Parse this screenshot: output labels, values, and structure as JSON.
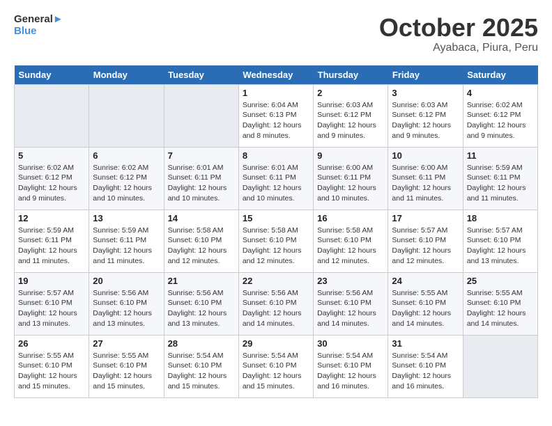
{
  "header": {
    "logo_line1": "General",
    "logo_line2": "Blue",
    "month": "October 2025",
    "location": "Ayabaca, Piura, Peru"
  },
  "weekdays": [
    "Sunday",
    "Monday",
    "Tuesday",
    "Wednesday",
    "Thursday",
    "Friday",
    "Saturday"
  ],
  "weeks": [
    [
      {
        "day": "",
        "empty": true
      },
      {
        "day": "",
        "empty": true
      },
      {
        "day": "",
        "empty": true
      },
      {
        "day": "1",
        "lines": [
          "Sunrise: 6:04 AM",
          "Sunset: 6:13 PM",
          "Daylight: 12 hours",
          "and 8 minutes."
        ]
      },
      {
        "day": "2",
        "lines": [
          "Sunrise: 6:03 AM",
          "Sunset: 6:12 PM",
          "Daylight: 12 hours",
          "and 9 minutes."
        ]
      },
      {
        "day": "3",
        "lines": [
          "Sunrise: 6:03 AM",
          "Sunset: 6:12 PM",
          "Daylight: 12 hours",
          "and 9 minutes."
        ]
      },
      {
        "day": "4",
        "lines": [
          "Sunrise: 6:02 AM",
          "Sunset: 6:12 PM",
          "Daylight: 12 hours",
          "and 9 minutes."
        ]
      }
    ],
    [
      {
        "day": "5",
        "lines": [
          "Sunrise: 6:02 AM",
          "Sunset: 6:12 PM",
          "Daylight: 12 hours",
          "and 9 minutes."
        ]
      },
      {
        "day": "6",
        "lines": [
          "Sunrise: 6:02 AM",
          "Sunset: 6:12 PM",
          "Daylight: 12 hours",
          "and 10 minutes."
        ]
      },
      {
        "day": "7",
        "lines": [
          "Sunrise: 6:01 AM",
          "Sunset: 6:11 PM",
          "Daylight: 12 hours",
          "and 10 minutes."
        ]
      },
      {
        "day": "8",
        "lines": [
          "Sunrise: 6:01 AM",
          "Sunset: 6:11 PM",
          "Daylight: 12 hours",
          "and 10 minutes."
        ]
      },
      {
        "day": "9",
        "lines": [
          "Sunrise: 6:00 AM",
          "Sunset: 6:11 PM",
          "Daylight: 12 hours",
          "and 10 minutes."
        ]
      },
      {
        "day": "10",
        "lines": [
          "Sunrise: 6:00 AM",
          "Sunset: 6:11 PM",
          "Daylight: 12 hours",
          "and 11 minutes."
        ]
      },
      {
        "day": "11",
        "lines": [
          "Sunrise: 5:59 AM",
          "Sunset: 6:11 PM",
          "Daylight: 12 hours",
          "and 11 minutes."
        ]
      }
    ],
    [
      {
        "day": "12",
        "lines": [
          "Sunrise: 5:59 AM",
          "Sunset: 6:11 PM",
          "Daylight: 12 hours",
          "and 11 minutes."
        ]
      },
      {
        "day": "13",
        "lines": [
          "Sunrise: 5:59 AM",
          "Sunset: 6:11 PM",
          "Daylight: 12 hours",
          "and 11 minutes."
        ]
      },
      {
        "day": "14",
        "lines": [
          "Sunrise: 5:58 AM",
          "Sunset: 6:10 PM",
          "Daylight: 12 hours",
          "and 12 minutes."
        ]
      },
      {
        "day": "15",
        "lines": [
          "Sunrise: 5:58 AM",
          "Sunset: 6:10 PM",
          "Daylight: 12 hours",
          "and 12 minutes."
        ]
      },
      {
        "day": "16",
        "lines": [
          "Sunrise: 5:58 AM",
          "Sunset: 6:10 PM",
          "Daylight: 12 hours",
          "and 12 minutes."
        ]
      },
      {
        "day": "17",
        "lines": [
          "Sunrise: 5:57 AM",
          "Sunset: 6:10 PM",
          "Daylight: 12 hours",
          "and 12 minutes."
        ]
      },
      {
        "day": "18",
        "lines": [
          "Sunrise: 5:57 AM",
          "Sunset: 6:10 PM",
          "Daylight: 12 hours",
          "and 13 minutes."
        ]
      }
    ],
    [
      {
        "day": "19",
        "lines": [
          "Sunrise: 5:57 AM",
          "Sunset: 6:10 PM",
          "Daylight: 12 hours",
          "and 13 minutes."
        ]
      },
      {
        "day": "20",
        "lines": [
          "Sunrise: 5:56 AM",
          "Sunset: 6:10 PM",
          "Daylight: 12 hours",
          "and 13 minutes."
        ]
      },
      {
        "day": "21",
        "lines": [
          "Sunrise: 5:56 AM",
          "Sunset: 6:10 PM",
          "Daylight: 12 hours",
          "and 13 minutes."
        ]
      },
      {
        "day": "22",
        "lines": [
          "Sunrise: 5:56 AM",
          "Sunset: 6:10 PM",
          "Daylight: 12 hours",
          "and 14 minutes."
        ]
      },
      {
        "day": "23",
        "lines": [
          "Sunrise: 5:56 AM",
          "Sunset: 6:10 PM",
          "Daylight: 12 hours",
          "and 14 minutes."
        ]
      },
      {
        "day": "24",
        "lines": [
          "Sunrise: 5:55 AM",
          "Sunset: 6:10 PM",
          "Daylight: 12 hours",
          "and 14 minutes."
        ]
      },
      {
        "day": "25",
        "lines": [
          "Sunrise: 5:55 AM",
          "Sunset: 6:10 PM",
          "Daylight: 12 hours",
          "and 14 minutes."
        ]
      }
    ],
    [
      {
        "day": "26",
        "lines": [
          "Sunrise: 5:55 AM",
          "Sunset: 6:10 PM",
          "Daylight: 12 hours",
          "and 15 minutes."
        ]
      },
      {
        "day": "27",
        "lines": [
          "Sunrise: 5:55 AM",
          "Sunset: 6:10 PM",
          "Daylight: 12 hours",
          "and 15 minutes."
        ]
      },
      {
        "day": "28",
        "lines": [
          "Sunrise: 5:54 AM",
          "Sunset: 6:10 PM",
          "Daylight: 12 hours",
          "and 15 minutes."
        ]
      },
      {
        "day": "29",
        "lines": [
          "Sunrise: 5:54 AM",
          "Sunset: 6:10 PM",
          "Daylight: 12 hours",
          "and 15 minutes."
        ]
      },
      {
        "day": "30",
        "lines": [
          "Sunrise: 5:54 AM",
          "Sunset: 6:10 PM",
          "Daylight: 12 hours",
          "and 16 minutes."
        ]
      },
      {
        "day": "31",
        "lines": [
          "Sunrise: 5:54 AM",
          "Sunset: 6:10 PM",
          "Daylight: 12 hours",
          "and 16 minutes."
        ]
      },
      {
        "day": "",
        "empty": true
      }
    ]
  ]
}
